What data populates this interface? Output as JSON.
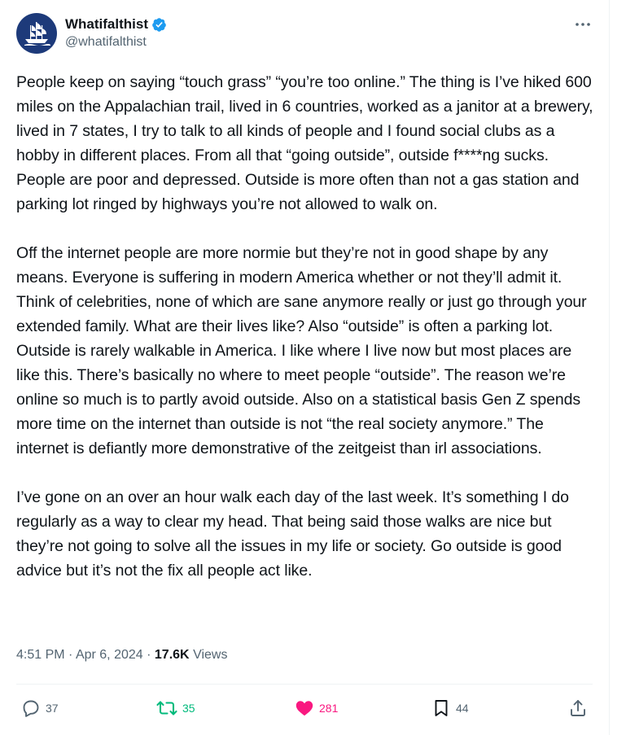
{
  "author": {
    "display_name": "Whatifalthist",
    "handle": "@whatifalthist",
    "avatar_icon": "ship-icon",
    "verified": true
  },
  "post": {
    "paragraphs": [
      "People keep on saying “touch grass” “you’re too online.” The thing is I’ve hiked 600 miles on the Appalachian trail, lived in 6 countries, worked as a janitor at a brewery, lived in 7 states, I try to talk to all kinds of people and I found social clubs as a hobby in different places. From all that “going outside”, outside f****ng sucks. People are poor and depressed. Outside is more often than not a gas station and parking lot ringed by highways you’re not allowed to walk on.",
      "Off the internet people are more normie but they’re not in good shape by any means. Everyone is suffering in modern America whether or not they’ll admit it. Think of celebrities, none of which are sane anymore really or just go through your extended family. What are their lives like? Also “outside” is often a parking lot. Outside is rarely walkable in America. I like where I live now but most places are like this. There’s basically no where to meet people “outside”. The reason we’re online so much is to partly avoid outside. Also on a statistical basis Gen Z spends more time on the internet than outside is not “the real society anymore.” The internet is defiantly more demonstrative of the zeitgeist than irl associations.",
      "I’ve gone on an over an hour walk each day of the last week. It’s something I do regularly as a way to clear my head. That being said those walks are nice but they’re not going to solve all the issues in my life or society. Go outside is good advice but it’s not the fix all people act like."
    ],
    "time": "4:51 PM",
    "date": "Apr 6, 2024",
    "separator": "·",
    "views_count": "17.6K",
    "views_label": "Views"
  },
  "actions": {
    "replies": "37",
    "reposts": "35",
    "likes": "281",
    "bookmarks": "44"
  },
  "colors": {
    "text": "#0f1419",
    "muted": "#536471",
    "verified_blue": "#1d9bf0",
    "repost_green": "#00ba7c",
    "like_pink": "#f91880",
    "avatar_bg": "#1d3a7a"
  }
}
